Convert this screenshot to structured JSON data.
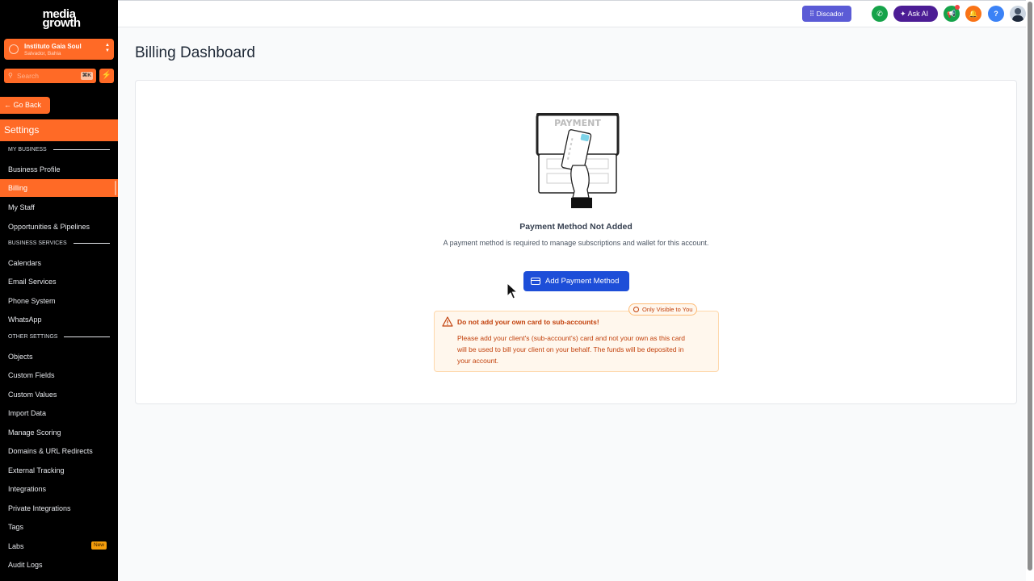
{
  "sidebar": {
    "logo_line1": "media",
    "logo_line2": "growth",
    "account": {
      "name": "Instituto Gaia Soul",
      "location": "Salvador, Bahia"
    },
    "search": {
      "placeholder": "Search",
      "shortcut": "⌘K"
    },
    "go_back": "Go Back",
    "settings_title": "Settings",
    "sections": {
      "my_business": "MY BUSINESS",
      "business_services": "BUSINESS SERVICES",
      "other_settings": "OTHER SETTINGS"
    },
    "items": {
      "business_profile": "Business Profile",
      "billing": "Billing",
      "my_staff": "My Staff",
      "opportunities": "Opportunities & Pipelines",
      "calendars": "Calendars",
      "email_services": "Email Services",
      "phone_system": "Phone System",
      "whatsapp": "WhatsApp",
      "objects": "Objects",
      "custom_fields": "Custom Fields",
      "custom_values": "Custom Values",
      "import_data": "Import Data",
      "manage_scoring": "Manage Scoring",
      "domains": "Domains & URL Redirects",
      "external_tracking": "External Tracking",
      "integrations": "Integrations",
      "private_integrations": "Private Integrations",
      "tags": "Tags",
      "labs": "Labs",
      "audit_logs": "Audit Logs"
    },
    "labs_badge": "New"
  },
  "topbar": {
    "discador": "Discador",
    "ask_ai": "Ask AI",
    "help": "?"
  },
  "page": {
    "title": "Billing Dashboard",
    "illustration_text": "PAYMENT",
    "empty_title": "Payment Method Not Added",
    "empty_desc": "A payment method is required to manage subscriptions and wallet for this account.",
    "add_button": "Add Payment Method",
    "visibility_badge": "Only Visible to You",
    "warning_title": "Do not add your own card to sub-accounts!",
    "warning_body": "Please add your client's (sub-account's) card and not your own as this card will be used to bill your client on your behalf. The funds will be deposited in your account."
  },
  "colors": {
    "accent": "#ff6a26",
    "primary_button": "#1d4ed8",
    "warning_text": "#c2410c"
  }
}
